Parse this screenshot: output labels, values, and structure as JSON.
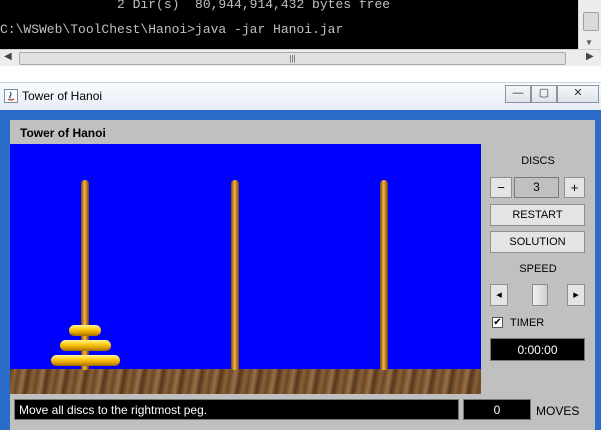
{
  "console": {
    "line1": "               2 Dir(s)  80,944,914,432 bytes free",
    "line2": "C:\\WSWeb\\ToolChest\\Hanoi>java -jar Hanoi.jar"
  },
  "window": {
    "title": "Tower of Hanoi",
    "minimize_glyph": "—",
    "maximize_glyph": "▢",
    "close_glyph": "✕"
  },
  "app": {
    "panel_title": "Tower of Hanoi",
    "discs_label": "DISCS",
    "discs_value": "3",
    "minus_label": "−",
    "plus_label": "+",
    "restart_label": "RESTART",
    "solution_label": "SOLUTION",
    "speed_label": "SPEED",
    "speed_left_glyph": "◂",
    "speed_right_glyph": "▸",
    "speed_level": 0.55,
    "timer_label": "TIMER",
    "timer_checked": true,
    "timer_value": "0:00:00",
    "status_message": "Move all discs to the rightmost peg.",
    "moves_value": "0",
    "moves_label": "MOVES"
  },
  "colors": {
    "board": "#0000ff",
    "frame": "#2b6cc9",
    "panel": "#c0c0c0",
    "disc": "#ffd21a",
    "peg": "#c98a24"
  },
  "icons": [
    "java-icon",
    "chevron-up-icon",
    "chevron-down-icon",
    "chevron-left-icon",
    "chevron-right-icon"
  ]
}
